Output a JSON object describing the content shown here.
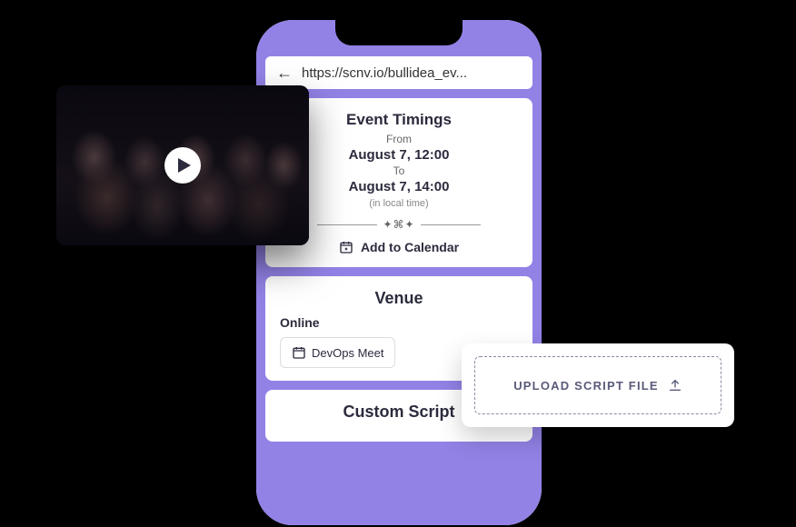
{
  "browser": {
    "url": "https://scnv.io/bullidea_ev..."
  },
  "event_timings": {
    "title": "Event Timings",
    "from_label": "From",
    "from_date": "August 7, 12:00",
    "to_label": "To",
    "to_date": "August 7, 14:00",
    "local_note": "(in local time)",
    "add_calendar": "Add to Calendar"
  },
  "venue": {
    "title": "Venue",
    "mode": "Online",
    "chip": "DevOps Meet"
  },
  "custom_script": {
    "title": "Custom Script"
  },
  "upload": {
    "label": "UPLOAD SCRIPT FILE"
  }
}
